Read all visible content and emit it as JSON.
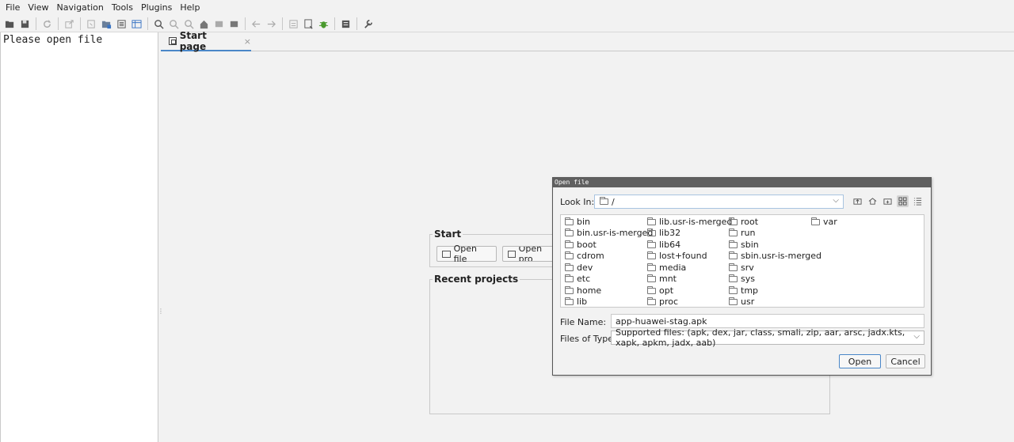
{
  "menu": [
    "File",
    "View",
    "Navigation",
    "Tools",
    "Plugins",
    "Help"
  ],
  "left_panel": {
    "message": "Please open file"
  },
  "tabs": [
    {
      "label": "Start page",
      "close": "×"
    }
  ],
  "start_page": {
    "start_title": "Start",
    "open_file_label": "Open file",
    "open_project_label": "Open pro",
    "recent_title": "Recent projects"
  },
  "dialog": {
    "title": "Open file",
    "look_in_label": "Look In:",
    "look_in_value": "/",
    "files": [
      "bin",
      "bin.usr-is-merged",
      "boot",
      "cdrom",
      "dev",
      "etc",
      "home",
      "lib",
      "lib.usr-is-merged",
      "lib32",
      "lib64",
      "lost+found",
      "media",
      "mnt",
      "opt",
      "proc",
      "root",
      "run",
      "sbin",
      "sbin.usr-is-merged",
      "srv",
      "sys",
      "tmp",
      "usr",
      "var"
    ],
    "file_name_label": "File Name:",
    "file_name_value": "app-huawei-stag.apk",
    "files_of_type_label": "Files of Type:",
    "files_of_type_value": "Supported files: (apk, dex, jar, class, smali, zip, aar, arsc, jadx.kts, xapk, apkm, jadx, aab)",
    "open_label": "Open",
    "cancel_label": "Cancel"
  }
}
